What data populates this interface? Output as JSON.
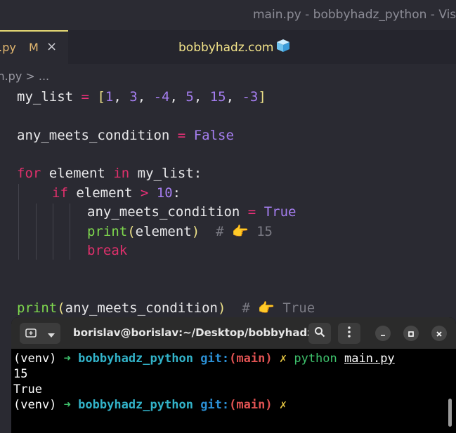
{
  "window": {
    "title": "main.py - bobbyhadz_python - Visu"
  },
  "tab": {
    "label": "n.py",
    "modified": "M",
    "close": "×"
  },
  "banner": {
    "text": "bobbyhadz.com",
    "icon": "ice-cube-icon"
  },
  "breadcrumb": "in.py > ...",
  "code": {
    "l1": {
      "name": "my_list",
      "eq": "=",
      "open": "[",
      "n1": "1",
      "n2": "3",
      "n3": "-4",
      "n4": "5",
      "n5": "15",
      "n6": "-3",
      "close": "]",
      "c": ", "
    },
    "l2": {
      "name": "any_meets_condition",
      "eq": "=",
      "val": "False"
    },
    "l3": {
      "for": "for",
      "var": "element",
      "in": "in",
      "iter": "my_list",
      "colon": ":"
    },
    "l4": {
      "if": "if",
      "var": "element",
      "gt": ">",
      "num": "10",
      "colon": ":"
    },
    "l5": {
      "name": "any_meets_condition",
      "eq": "=",
      "val": "True"
    },
    "l6": {
      "fn": "print",
      "open": "(",
      "arg": "element",
      "close": ")",
      "hash": "#",
      "emoji": "👉",
      "out": "15"
    },
    "l7": {
      "kw": "break"
    },
    "l8": {
      "fn": "print",
      "open": "(",
      "arg": "any_meets_condition",
      "close": ")",
      "hash": "#",
      "emoji": "👉",
      "out": "True"
    }
  },
  "terminal": {
    "title": "borislav@borislav:~/Desktop/bobbyhadz_...",
    "prompt": {
      "venv": "(venv)",
      "arrow": "➜",
      "dir": "bobbyhadz_python",
      "git": "git:",
      "open": "(",
      "branch": "main",
      "close": ")",
      "dirty": "✗"
    },
    "command": "python",
    "file": "main.py",
    "output": [
      "15",
      "True"
    ]
  },
  "colors": {
    "accent": "#e6d974",
    "terminal_bg": "#000000",
    "editor_bg": "#2a2a32"
  }
}
